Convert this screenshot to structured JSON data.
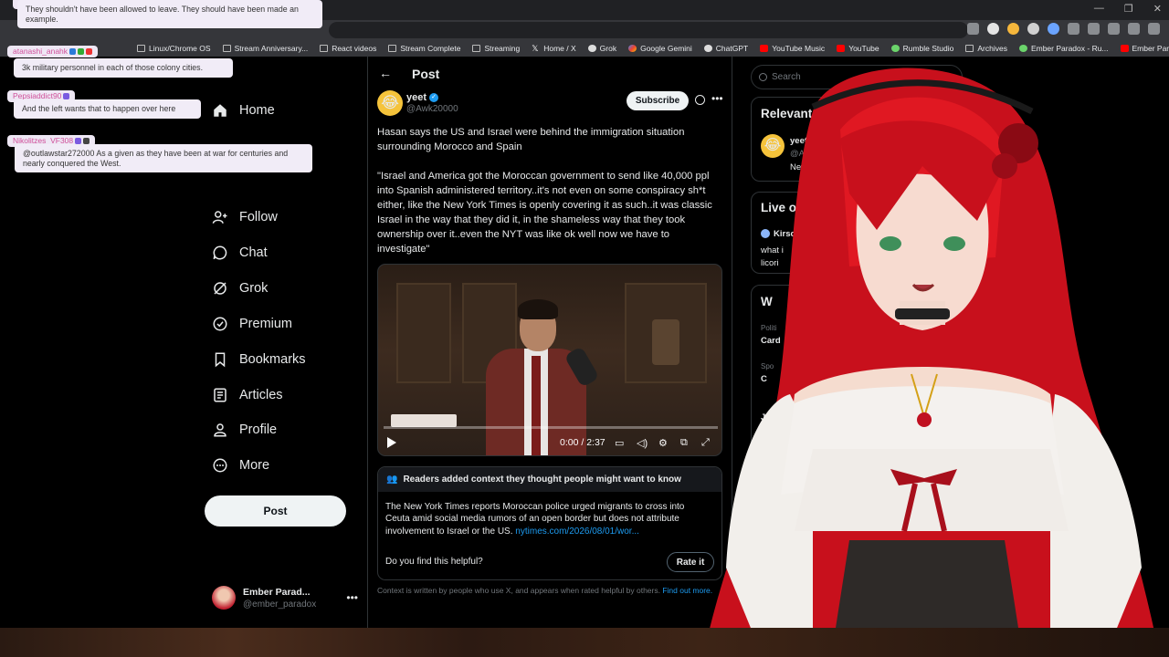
{
  "bookmarks": [
    "Linux/Chrome OS",
    "Stream Anniversary...",
    "React videos",
    "Stream Complete",
    "Streaming",
    "Home / X",
    "Grok",
    "Google Gemini",
    "ChatGPT",
    "YouTube Music",
    "YouTube",
    "Rumble Studio",
    "Archives",
    "Ember Paradox - Ru...",
    "Ember Paradox"
  ],
  "nav": {
    "items": [
      "Home",
      "Follow",
      "Chat",
      "Grok",
      "Premium",
      "Bookmarks",
      "Articles",
      "Profile",
      "More"
    ],
    "post_button": "Post",
    "profile": {
      "name": "Ember Parad...",
      "handle": "@ember_paradox"
    }
  },
  "post": {
    "header": "Post",
    "author": {
      "name": "yeet",
      "handle": "@Awk20000"
    },
    "subscribe_label": "Subscribe",
    "text_line1": "Hasan says the US and Israel were behind the immigration situation surrounding Morocco and Spain",
    "text_quote": "\"Israel and America got the Moroccan government to send like 40,000 ppl into Spanish administered territory..it's not even on some conspiracy sh*t either, like the New York Times is openly covering it as such..it was classic Israel in the way that they did it, in the shameless way that they took ownership over it..even the NYT was like ok well now we have to investigate\"",
    "video_time": "0:00 / 2:37",
    "video_progress": 0
  },
  "context": {
    "header": "Readers added context they thought people might want to know",
    "body": "The New York Times reports Moroccan police urged migrants to cross into Ceuta amid social media rumors of an open border but does not attribute involvement to Israel or the US.",
    "link": "nytimes.com/2026/08/01/wor...",
    "question": "Do you find this helpful?",
    "rate_label": "Rate it",
    "footer": "Context is written by people who use X, and appears when rated helpful by others.",
    "footer_link": "Find out more."
  },
  "right": {
    "search_placeholder": "Search",
    "relevant_title": "Relevant peo",
    "relevant_name": "yeet",
    "relevant_handle": "@Awk2",
    "relevant_snip": "News",
    "live_title": "Live on",
    "live_host": "Kirsc",
    "live_snip1": "what i",
    "live_snip2": "licori",
    "whats_title": "W",
    "trend1_cat": "Politi",
    "trend1": "Card",
    "trend2_cat": "Spo",
    "trend2": "C",
    "trend3": "J"
  },
  "chat": [
    {
      "user": "",
      "text": "They shouldn't have been allowed to leave. They should have been made an example."
    },
    {
      "user": "atanashi_anahk",
      "text": "3k military personnel in each of those colony cities."
    },
    {
      "user": "Pepsiaddict90",
      "text": "And the left wants that to happen over here"
    },
    {
      "user": "Nikolitzes_VF308",
      "text": "@outlawstar272000 As a given as they have been at war for centuries and nearly conquered the West."
    }
  ],
  "colors": {
    "accent": "#1d9bf0",
    "background": "#000000",
    "chat_bubble": "#f1ecf7",
    "chat_user": "#d0509a"
  }
}
